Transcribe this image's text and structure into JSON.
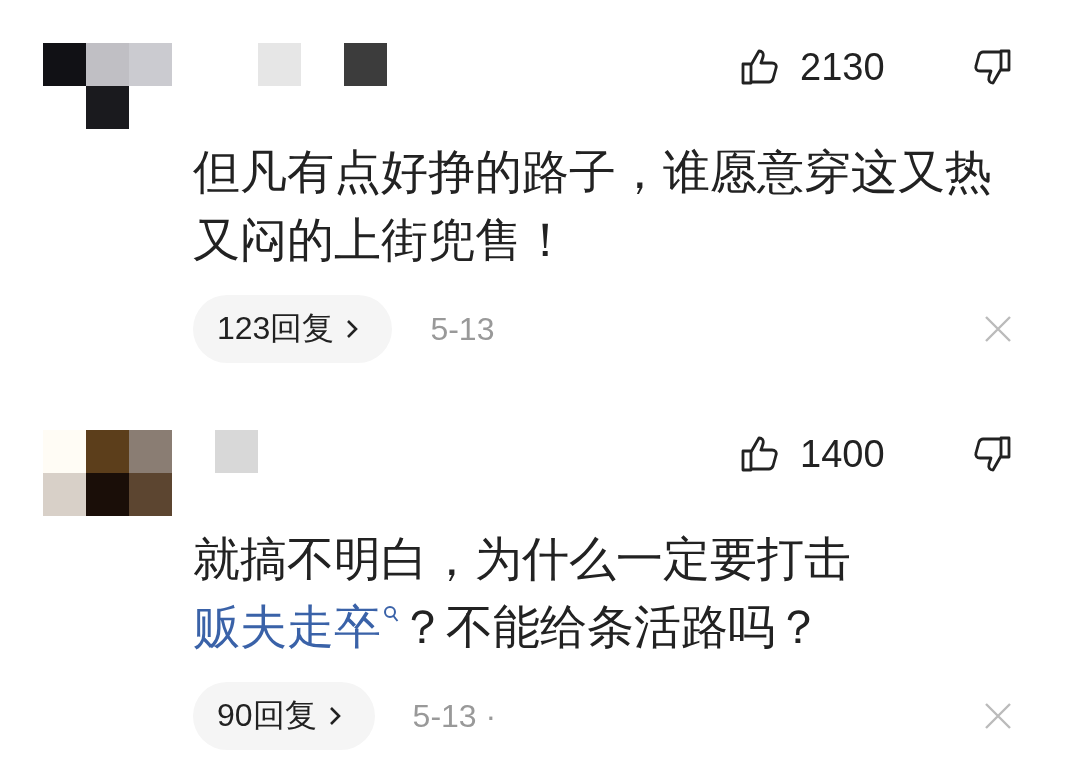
{
  "comments": [
    {
      "likes": "2130",
      "body": [
        {
          "kind": "text",
          "text": "但凡有点好挣的路子，谁愿意穿这又热又闷的上街兜售！"
        }
      ],
      "replies": "123回复",
      "date": "5-13"
    },
    {
      "likes": "1400",
      "body": [
        {
          "kind": "text",
          "text": "就搞不明白，为什么一定要打击"
        },
        {
          "kind": "link",
          "text": "贩夫走卒"
        },
        {
          "kind": "text",
          "text": "？不能给条活路吗？"
        }
      ],
      "replies": "90回复",
      "date": "5-13 ·"
    }
  ]
}
